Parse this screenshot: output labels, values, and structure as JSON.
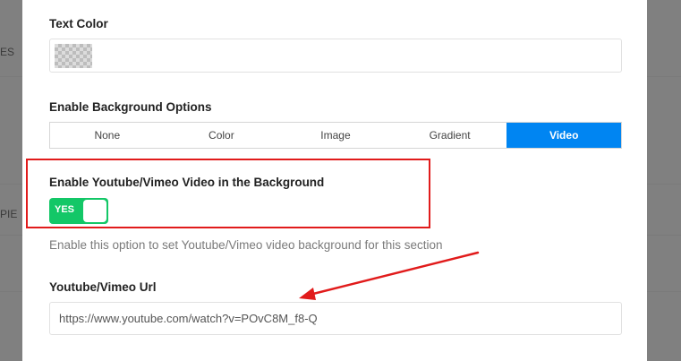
{
  "background_page": {
    "fragments": [
      "ES",
      "PIE"
    ]
  },
  "modal": {
    "text_color": {
      "label": "Text Color",
      "swatch_icon": "transparent-checker-icon"
    },
    "background_options": {
      "label": "Enable Background Options",
      "options": [
        "None",
        "Color",
        "Image",
        "Gradient",
        "Video"
      ],
      "selected": "Video",
      "accent_color": "#0085f2"
    },
    "video_toggle": {
      "label": "Enable Youtube/Vimeo Video in the Background",
      "state_text": "YES",
      "state": true,
      "color": "#13c767",
      "help": "Enable this option to set Youtube/Vimeo video background for this section"
    },
    "video_url": {
      "label": "Youtube/Vimeo Url",
      "value": "https://www.youtube.com/watch?v=POvC8M_f8-Q"
    }
  },
  "annotations": {
    "highlight_color": "#e11b1b",
    "arrow_icon": "red-arrow-icon"
  }
}
